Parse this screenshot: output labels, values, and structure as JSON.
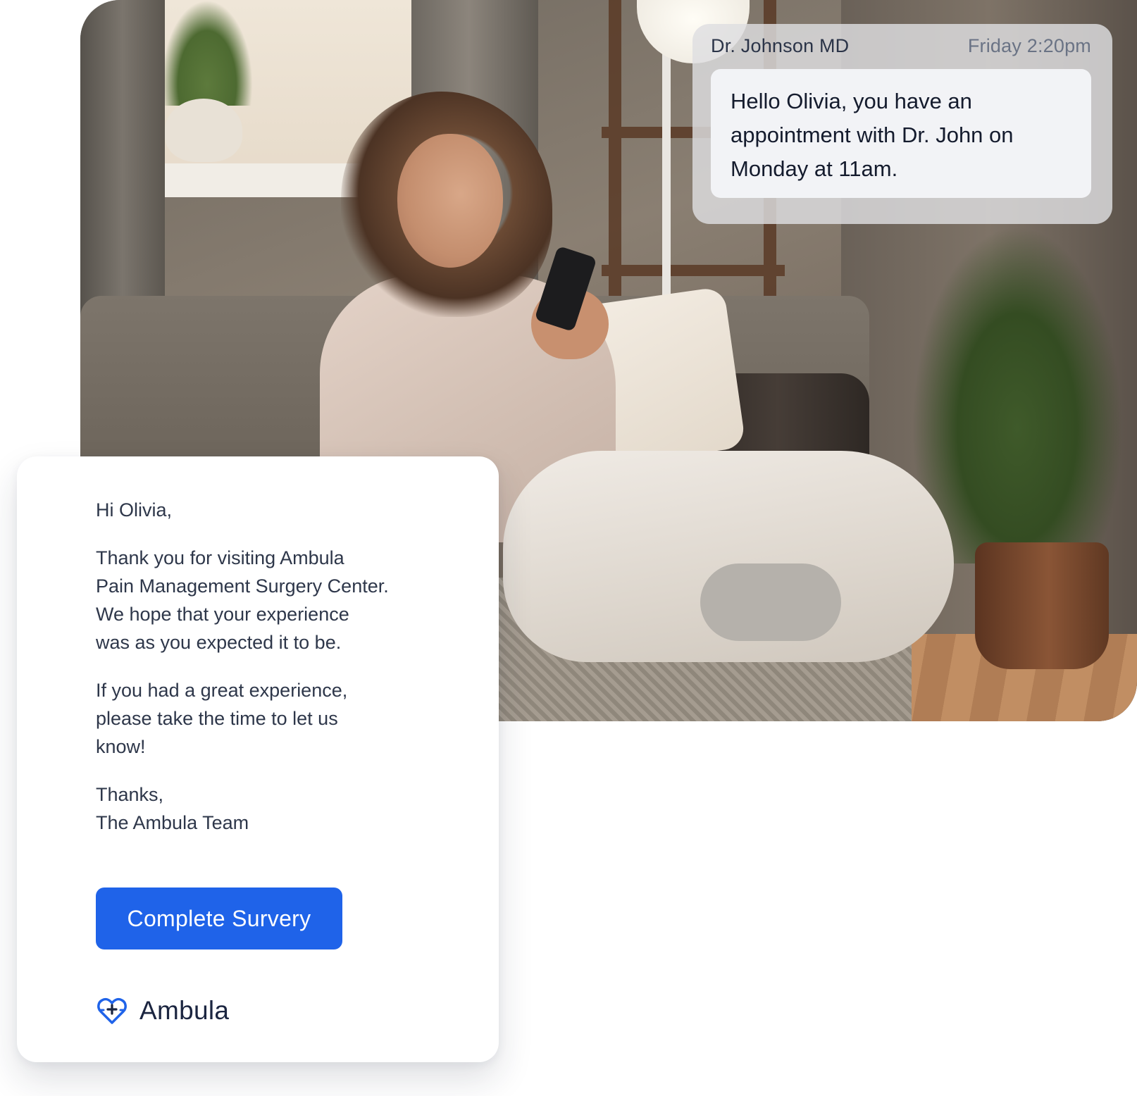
{
  "chat": {
    "sender": "Dr. Johnson MD",
    "time": "Friday 2:20pm",
    "message_lines": [
      "Hello Olivia, you have an",
      "appointment with Dr. John on",
      "Monday at 11am."
    ]
  },
  "email": {
    "greeting": "Hi Olivia,",
    "paragraph1_lines": [
      "Thank you for visiting Ambula",
      "Pain Management Surgery Center.",
      "We hope that your experience",
      "was as you expected it to be."
    ],
    "paragraph2_lines": [
      "If you had a great experience,",
      "please take the time to let us",
      "know!"
    ],
    "signoff_lines": [
      "Thanks,",
      "The Ambula Team"
    ],
    "cta_label": "Complete Survery",
    "brand_name": "Ambula",
    "brand_icon": "heart-plus-icon"
  },
  "colors": {
    "accent": "#1f63e9",
    "text_primary": "#1b2540",
    "text_body": "#2e374a",
    "bubble_bg": "#f2f3f6"
  }
}
